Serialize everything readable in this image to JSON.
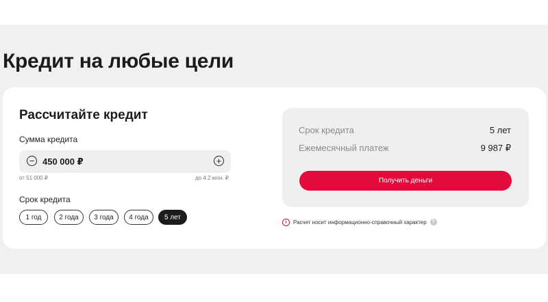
{
  "page": {
    "title": "Кредит на любые цели"
  },
  "calculator": {
    "title": "Рассчитайте кредит",
    "amount": {
      "label": "Сумма кредита",
      "value": "450 000 ₽",
      "decrement_symbol": "−",
      "increment_symbol": "+",
      "min_label": "от 51 000 ₽",
      "max_label": "до 4.2 млн. ₽"
    },
    "term": {
      "label": "Срок кредита",
      "options": [
        "1 год",
        "2 года",
        "3 года",
        "4 года",
        "5 лет"
      ],
      "selected": "5 лет"
    }
  },
  "result": {
    "term_label": "Срок кредита",
    "term_value": "5 лет",
    "payment_label": "Ежемесячный платеж",
    "payment_value": "9 987 ₽",
    "cta_label": "Получить деньги"
  },
  "disclaimer": {
    "icon": "info-icon",
    "text": "Расчет носит информационно-справочный характер",
    "help_symbol": "?"
  },
  "colors": {
    "accent": "#e30b3c",
    "page_background": "#f0f0f0",
    "card_background": "#ffffff",
    "panel_background": "#efefef",
    "selected_chip": "#1c1c1c"
  }
}
